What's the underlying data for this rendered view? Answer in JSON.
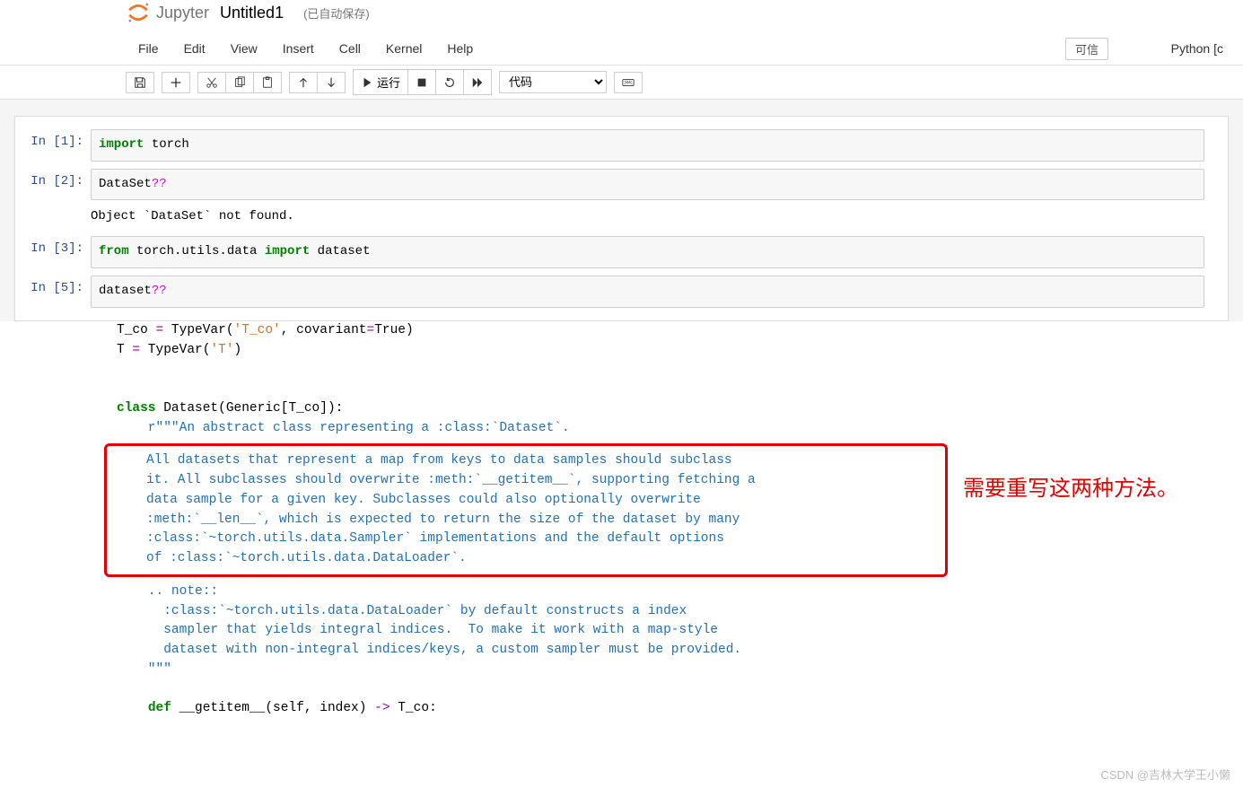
{
  "header": {
    "logo_text": "Jupyter",
    "notebook_name": "Untitled1",
    "autosave": "(已自动保存)"
  },
  "menubar": {
    "items": [
      "File",
      "Edit",
      "View",
      "Insert",
      "Cell",
      "Kernel",
      "Help"
    ],
    "trust": "可信",
    "kernel": "Python [c"
  },
  "toolbar": {
    "run_label": "运行",
    "cell_type": "代码"
  },
  "cells": [
    {
      "prompt": "In  [1]:",
      "code_html": "<span class='kw'>import</span> <span class='name'>torch</span>"
    },
    {
      "prompt": "In  [2]:",
      "code_html": "<span class='name'>DataSet</span><span class='q'>??</span>",
      "output": "Object `DataSet` not found."
    },
    {
      "prompt": "In  [3]:",
      "code_html": "<span class='kw'>from</span> <span class='name'>torch.utils.data</span> <span class='kw'>import</span> <span class='name'>dataset</span>"
    },
    {
      "prompt": "In  [5]:",
      "code_html": "<span class='name'>dataset</span><span class='q'>??</span>"
    }
  ],
  "source": {
    "pre_lines": [
      "T_co = TypeVar('T_co', covariant=True)",
      "T = TypeVar('T')",
      ""
    ],
    "class_line_prefix": "class",
    "class_line_rest": " Dataset(Generic[T_co]):",
    "doc_open": "    r\"\"\"An abstract class representing a :class:`Dataset`.",
    "box_lines": [
      "All datasets that represent a map from keys to data samples should subclass",
      "it. All subclasses should overwrite :meth:`__getitem__`, supporting fetching a",
      "data sample for a given key. Subclasses could also optionally overwrite",
      ":meth:`__len__`, which is expected to return the size of the dataset by many",
      ":class:`~torch.utils.data.Sampler` implementations and the default options",
      "of :class:`~torch.utils.data.DataLoader`."
    ],
    "post_box_lines": [
      "",
      "    .. note::",
      "      :class:`~torch.utils.data.DataLoader` by default constructs a index",
      "      sampler that yields integral indices.  To make it work with a map-style",
      "      dataset with non-integral indices/keys, a custom sampler must be provided.",
      "    \"\"\"",
      ""
    ],
    "def_line": "    def __getitem__(self, index) -> T_co:"
  },
  "annotation": "需要重写这两种方法。",
  "watermark": "CSDN @吉林大学王小懒"
}
